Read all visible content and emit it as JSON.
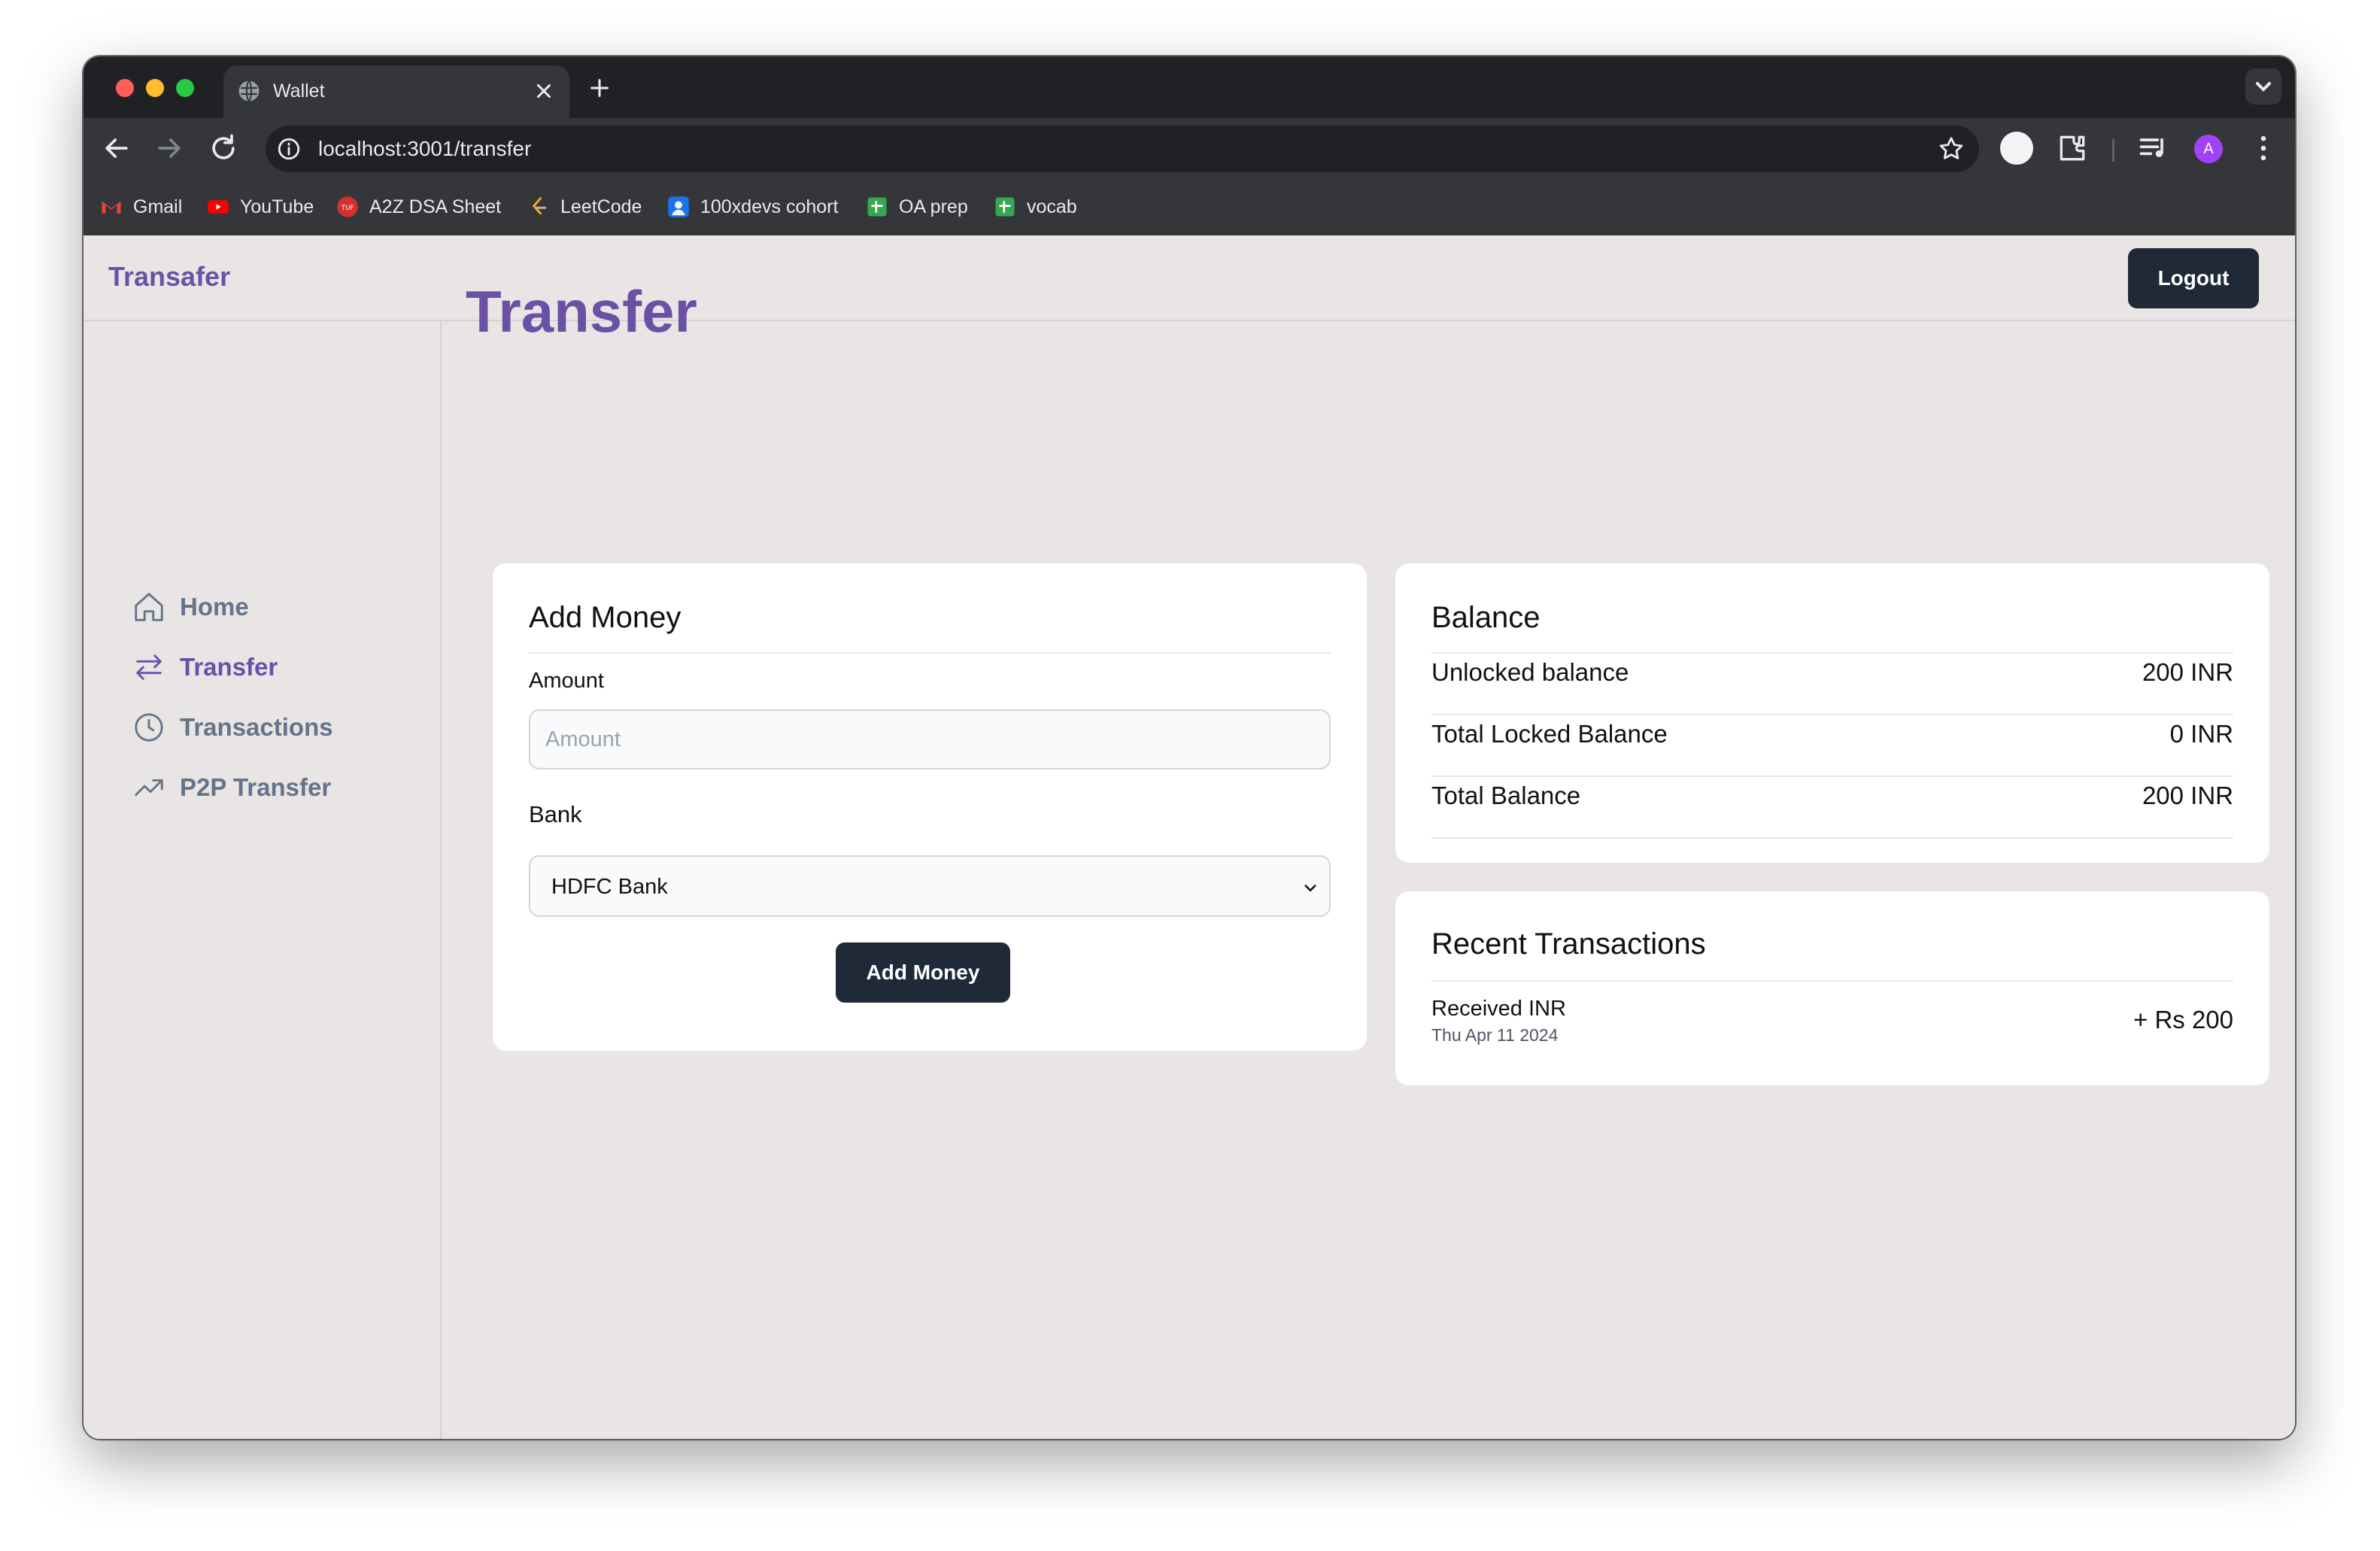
{
  "browser": {
    "tab_title": "Wallet",
    "url": "localhost:3001/transfer",
    "bookmarks": [
      {
        "label": "Gmail",
        "icon": "gmail-icon"
      },
      {
        "label": "YouTube",
        "icon": "youtube-icon"
      },
      {
        "label": "A2Z DSA Sheet",
        "icon": "tuf-icon"
      },
      {
        "label": "LeetCode",
        "icon": "leetcode-icon"
      },
      {
        "label": "100xdevs cohort",
        "icon": "cohort-icon"
      },
      {
        "label": "OA prep",
        "icon": "sheets-icon"
      },
      {
        "label": "vocab",
        "icon": "sheets-icon"
      }
    ],
    "profile_initial": "A"
  },
  "app": {
    "brand": "Transafer",
    "logout_label": "Logout"
  },
  "sidebar": {
    "items": [
      {
        "label": "Home",
        "icon": "home-icon",
        "active": false
      },
      {
        "label": "Transfer",
        "icon": "transfer-arrows-icon",
        "active": true
      },
      {
        "label": "Transactions",
        "icon": "clock-icon",
        "active": false
      },
      {
        "label": "P2P Transfer",
        "icon": "trending-up-icon",
        "active": false
      }
    ]
  },
  "main": {
    "page_title": "Transfer",
    "add_money": {
      "title": "Add Money",
      "amount_label": "Amount",
      "amount_placeholder": "Amount",
      "amount_value": "",
      "bank_label": "Bank",
      "bank_selected": "HDFC Bank",
      "submit_label": "Add Money"
    },
    "balance": {
      "title": "Balance",
      "rows": [
        {
          "label": "Unlocked balance",
          "value": "200 INR"
        },
        {
          "label": "Total Locked Balance",
          "value": "0 INR"
        },
        {
          "label": "Total Balance",
          "value": "200 INR"
        }
      ]
    },
    "recent_transactions": {
      "title": "Recent Transactions",
      "items": [
        {
          "title": "Received INR",
          "date": "Thu Apr 11 2024",
          "amount": "+ Rs 200"
        }
      ]
    }
  },
  "colors": {
    "brand": "#6a51a6",
    "muted_nav": "#64748b",
    "dark_button": "#1f2937",
    "app_background": "#e9e5e5"
  }
}
